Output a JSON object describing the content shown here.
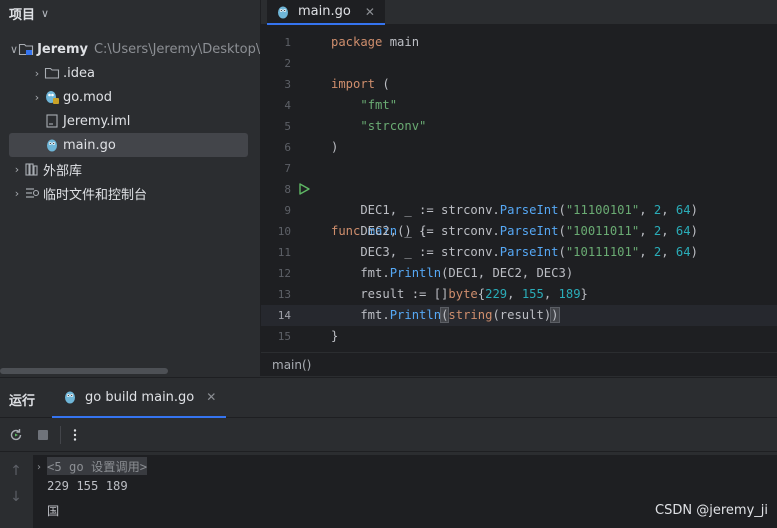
{
  "project_panel": {
    "title": "项目",
    "tree": [
      {
        "label": "Jeremy",
        "path": "C:\\Users\\Jeremy\\Desktop\\G",
        "icon": "project-folder-icon"
      },
      {
        "label": ".idea",
        "icon": "folder-icon"
      },
      {
        "label": "go.mod",
        "icon": "gomod-icon"
      },
      {
        "label": "Jeremy.iml",
        "icon": "iml-file-icon"
      },
      {
        "label": "main.go",
        "icon": "go-file-icon"
      },
      {
        "label": "外部库",
        "icon": "library-icon"
      },
      {
        "label": "临时文件和控制台",
        "icon": "scratches-icon"
      }
    ]
  },
  "editor": {
    "tab_label": "main.go",
    "breadcrumb": "main()",
    "line_numbers": [
      "1",
      "2",
      "3",
      "4",
      "5",
      "6",
      "7",
      "8",
      "9",
      "10",
      "11",
      "12",
      "13",
      "14",
      "15"
    ],
    "current_line": 14
  },
  "run_panel": {
    "title": "运行",
    "tab_label": "go build main.go",
    "console": {
      "fold_hint": "<5 go 设置调用>",
      "output": [
        "229 155 189",
        "国"
      ]
    }
  },
  "watermark": "CSDN @jeremy_ji",
  "colors": {
    "accent": "#3574f0",
    "keyword": "#cf8e6d",
    "string": "#6aab73",
    "function": "#56a8f5",
    "number": "#2aacb8"
  }
}
